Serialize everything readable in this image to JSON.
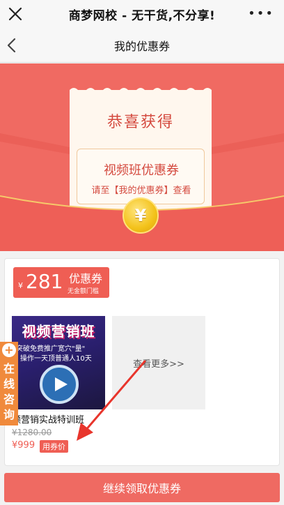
{
  "topbar": {
    "title": "商梦网校 - 无干货,不分享!",
    "more": "•••"
  },
  "navbar": {
    "title": "我的优惠券"
  },
  "banner": {
    "congrats": "恭喜获得",
    "coupon_type": "视频班优惠券",
    "hint": "请至【我的优惠券】查看",
    "coin_symbol": "¥"
  },
  "coupon": {
    "currency": "¥",
    "amount": "281",
    "label": "优惠券",
    "threshold": "无金额门槛"
  },
  "course": {
    "thumb_title": "视频营销班",
    "thumb_line1": "突破免费推广宽穴\"量\"",
    "thumb_line2": "操作一天顶普通人10天",
    "name": "频营销实战特训班",
    "original_price": "¥1280.00",
    "price": "¥999",
    "price_tag": "用券价"
  },
  "more_link": "查看更多>>",
  "side_widget": {
    "plus": "+",
    "text": "在线咨询"
  },
  "cta": {
    "label": "继续领取优惠券"
  },
  "colors": {
    "accent": "#ef5e54",
    "banner": "#f06a62",
    "side": "#f08a3c"
  }
}
